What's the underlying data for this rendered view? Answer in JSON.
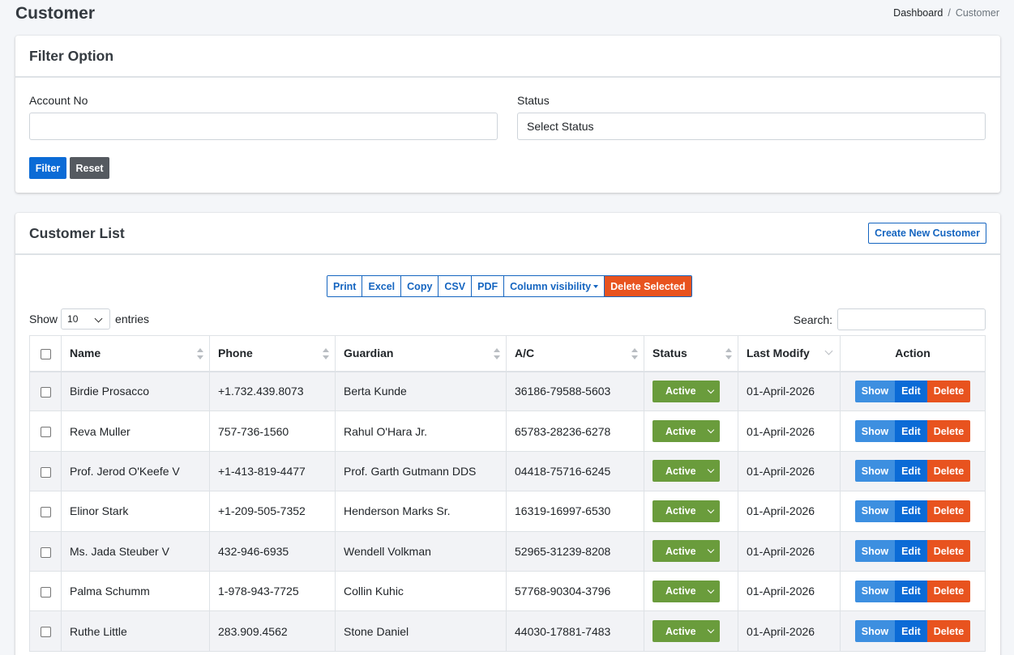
{
  "page": {
    "title": "Customer"
  },
  "breadcrumb": {
    "home": "Dashboard",
    "separator": "/",
    "current": "Customer"
  },
  "filter": {
    "title": "Filter Option",
    "account_label": "Account No",
    "account_value": "",
    "status_label": "Status",
    "status_value": "Select Status",
    "filter_button": "Filter",
    "reset_button": "Reset"
  },
  "list": {
    "title": "Customer List",
    "create_button": "Create New Customer",
    "export_buttons": {
      "print": "Print",
      "excel": "Excel",
      "copy": "Copy",
      "csv": "CSV",
      "pdf": "PDF",
      "column_visibility": "Column visibility",
      "delete_selected": "Delete Selected"
    },
    "show_label": "Show",
    "page_length": "10",
    "entries_label": "entries",
    "search_label": "Search:",
    "search_value": "",
    "columns": {
      "name": "Name",
      "phone": "Phone",
      "guardian": "Guardian",
      "ac": "A/C",
      "status": "Status",
      "last_modify": "Last Modify",
      "action": "Action"
    },
    "action_labels": {
      "show": "Show",
      "edit": "Edit",
      "delete": "Delete"
    },
    "rows": [
      {
        "name": "Birdie Prosacco",
        "phone": "+1.732.439.8073",
        "guardian": "Berta Kunde",
        "ac": "36186-79588-5603",
        "status": "Active",
        "last_modify": "01-April-2026"
      },
      {
        "name": "Reva Muller",
        "phone": "757-736-1560",
        "guardian": "Rahul O'Hara Jr.",
        "ac": "65783-28236-6278",
        "status": "Active",
        "last_modify": "01-April-2026"
      },
      {
        "name": "Prof. Jerod O'Keefe V",
        "phone": "+1-413-819-4477",
        "guardian": "Prof. Garth Gutmann DDS",
        "ac": "04418-75716-6245",
        "status": "Active",
        "last_modify": "01-April-2026"
      },
      {
        "name": "Elinor Stark",
        "phone": "+1-209-505-7352",
        "guardian": "Henderson Marks Sr.",
        "ac": "16319-16997-6530",
        "status": "Active",
        "last_modify": "01-April-2026"
      },
      {
        "name": "Ms. Jada Steuber V",
        "phone": "432-946-6935",
        "guardian": "Wendell Volkman",
        "ac": "52965-31239-8208",
        "status": "Active",
        "last_modify": "01-April-2026"
      },
      {
        "name": "Palma Schumm",
        "phone": "1-978-943-7725",
        "guardian": "Collin Kuhic",
        "ac": "57768-90304-3796",
        "status": "Active",
        "last_modify": "01-April-2026"
      },
      {
        "name": "Ruthe Little",
        "phone": "283.909.4562",
        "guardian": "Stone Daniel",
        "ac": "44030-17881-7483",
        "status": "Active",
        "last_modify": "01-April-2026"
      }
    ]
  },
  "colors": {
    "primary": "#0b6bd6",
    "show": "#3d8fe0",
    "danger": "#e8531f",
    "success": "#6a9c3c",
    "secondary": "#555a60"
  }
}
